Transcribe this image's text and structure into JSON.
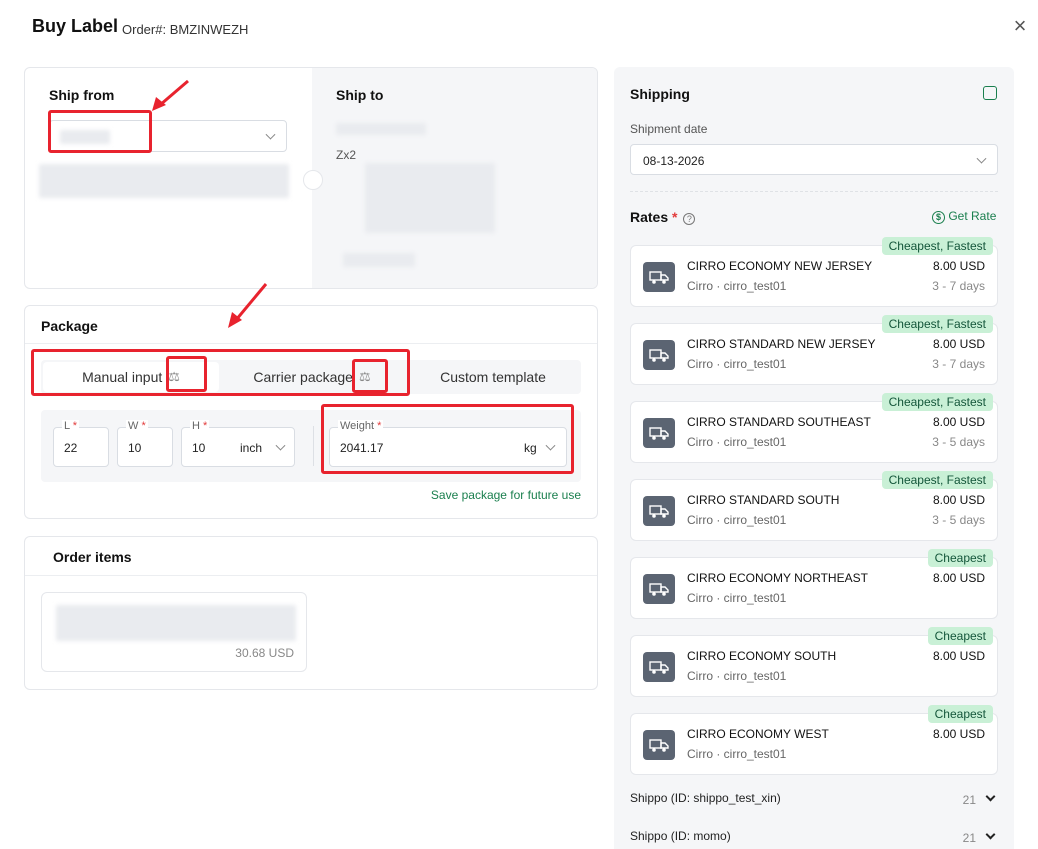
{
  "header": {
    "title": "Buy Label",
    "order_prefix": "Order#:",
    "order_id": "BMZINWEZH",
    "close": "×"
  },
  "ship_from": {
    "label": "Ship from"
  },
  "ship_to": {
    "label": "Ship to",
    "partial_text": "Zx2"
  },
  "package": {
    "label": "Package",
    "tabs": [
      "Manual input",
      "Carrier package",
      "Custom template"
    ],
    "dims": {
      "l_label": "L",
      "w_label": "W",
      "h_label": "H",
      "l": "22",
      "w": "10",
      "h": "10",
      "unit": "inch"
    },
    "weight": {
      "label": "Weight",
      "value": "2041.17",
      "unit": "kg"
    },
    "save_link": "Save package for future use"
  },
  "order_items": {
    "label": "Order items",
    "price": "30.68 USD"
  },
  "shipping": {
    "label": "Shipping",
    "date_label": "Shipment date",
    "date": "08-13-2026",
    "rates_label": "Rates",
    "get_rate": "Get Rate",
    "rates": [
      {
        "name": "CIRRO ECONOMY NEW JERSEY",
        "carrier": "Cirro · cirro_test01",
        "price": "8.00 USD",
        "days": "3 - 7 days",
        "badge": "Cheapest, Fastest"
      },
      {
        "name": "CIRRO STANDARD NEW JERSEY",
        "carrier": "Cirro · cirro_test01",
        "price": "8.00 USD",
        "days": "3 - 7 days",
        "badge": "Cheapest, Fastest"
      },
      {
        "name": "CIRRO STANDARD SOUTHEAST",
        "carrier": "Cirro · cirro_test01",
        "price": "8.00 USD",
        "days": "3 - 5 days",
        "badge": "Cheapest, Fastest"
      },
      {
        "name": "CIRRO STANDARD SOUTH",
        "carrier": "Cirro · cirro_test01",
        "price": "8.00 USD",
        "days": "3 - 5 days",
        "badge": "Cheapest, Fastest"
      },
      {
        "name": "CIRRO ECONOMY NORTHEAST",
        "carrier": "Cirro · cirro_test01",
        "price": "8.00 USD",
        "days": "",
        "badge": "Cheapest"
      },
      {
        "name": "CIRRO ECONOMY SOUTH",
        "carrier": "Cirro · cirro_test01",
        "price": "8.00 USD",
        "days": "",
        "badge": "Cheapest"
      },
      {
        "name": "CIRRO ECONOMY WEST",
        "carrier": "Cirro · cirro_test01",
        "price": "8.00 USD",
        "days": "",
        "badge": "Cheapest"
      }
    ],
    "accounts": [
      {
        "name": "Shippo (ID: shippo_test_xin)",
        "count": "21"
      },
      {
        "name": "Shippo (ID: momo)",
        "count": "21"
      }
    ]
  },
  "colors": {
    "accent": "#1a7f4e",
    "badge_bg": "#c9f0d6",
    "annotation_red": "#e8232e"
  }
}
